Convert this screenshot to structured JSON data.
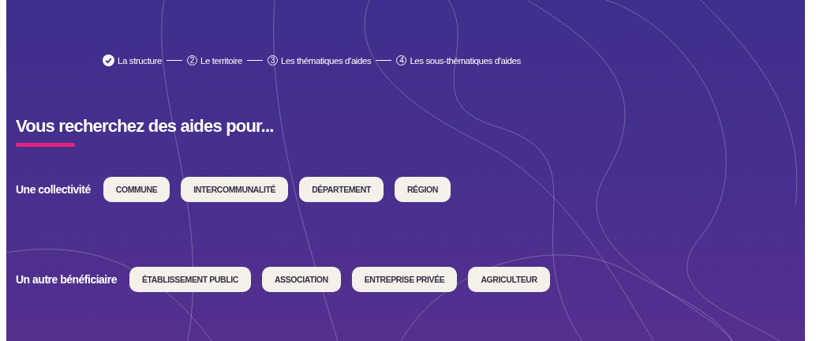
{
  "steps": [
    {
      "label": "La structure",
      "done": true
    },
    {
      "number": "2",
      "label": "Le territoire",
      "done": false
    },
    {
      "number": "3",
      "label": "Les thématiques d'aides",
      "done": false
    },
    {
      "number": "4",
      "label": "Les sous-thématiques d'aides",
      "done": false
    }
  ],
  "heading": "Vous recherchez des aides pour...",
  "groups": [
    {
      "label": "Une collectivité",
      "options": [
        "COMMUNE",
        "INTERCOMMUNALITÉ",
        "DÉPARTEMENT",
        "RÉGION"
      ]
    },
    {
      "label": "Un autre bénéficiaire",
      "options": [
        "ÉTABLISSEMENT PUBLIC",
        "ASSOCIATION",
        "ENTREPRISE PRIVÉE",
        "AGRICULTEUR"
      ]
    }
  ]
}
